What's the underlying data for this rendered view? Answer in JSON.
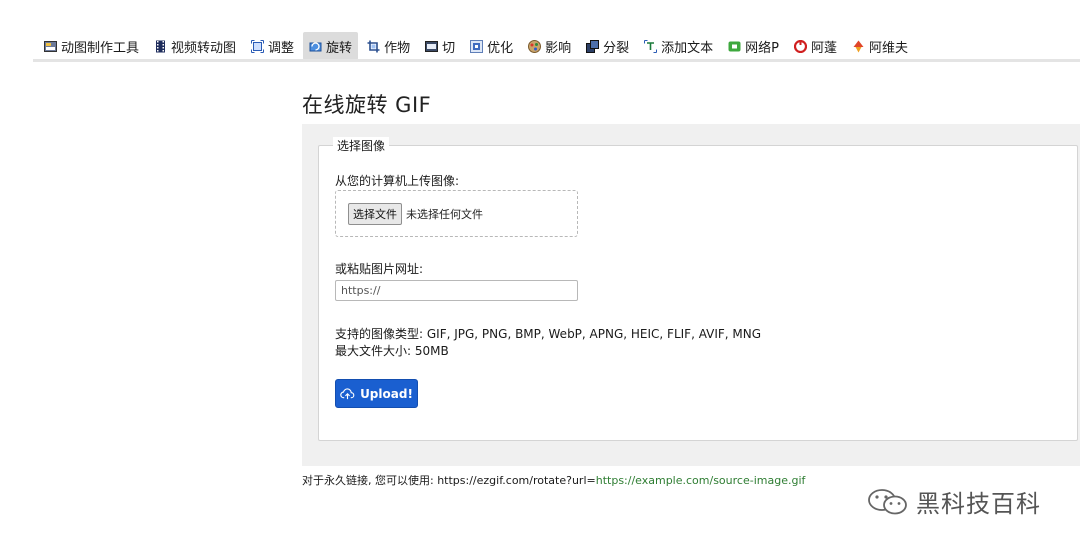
{
  "nav": {
    "items": [
      {
        "label": "动图制作工具",
        "icon": "gif-maker-icon"
      },
      {
        "label": "视频转动图",
        "icon": "film-icon"
      },
      {
        "label": "调整",
        "icon": "resize-icon"
      },
      {
        "label": "旋转",
        "icon": "rotate-icon",
        "active": true
      },
      {
        "label": "作物",
        "icon": "crop-icon"
      },
      {
        "label": "切",
        "icon": "cut-icon"
      },
      {
        "label": "优化",
        "icon": "optimize-icon"
      },
      {
        "label": "影响",
        "icon": "effects-icon"
      },
      {
        "label": "分裂",
        "icon": "split-icon"
      },
      {
        "label": "添加文本",
        "icon": "text-icon"
      },
      {
        "label": "网络P",
        "icon": "webp-icon"
      },
      {
        "label": "阿蓬",
        "icon": "apng-icon"
      },
      {
        "label": "阿维夫",
        "icon": "avif-icon"
      }
    ]
  },
  "page": {
    "title": "在线旋转 GIF"
  },
  "form": {
    "legend": "选择图像",
    "upload_label": "从您的计算机上传图像:",
    "file_button": "选择文件",
    "file_status": "未选择任何文件",
    "paste_label": "或粘贴图片网址:",
    "url_placeholder": "https://",
    "supported_types": "支持的图像类型: GIF, JPG, PNG, BMP, WebP, APNG, HEIC, FLIF, AVIF, MNG",
    "max_size": "最大文件大小: 50MB",
    "upload_button": "Upload!"
  },
  "permalink": {
    "prefix": "对于永久链接, 您可以使用: https://ezgif.com/rotate?url=",
    "link": "https://example.com/source-image.gif"
  },
  "watermark": {
    "text": "黑科技百科",
    "icon": "wechat-icon"
  },
  "colors": {
    "accent": "#1a5fd0",
    "link": "#2e7d32",
    "panel": "#f0f0f0"
  }
}
